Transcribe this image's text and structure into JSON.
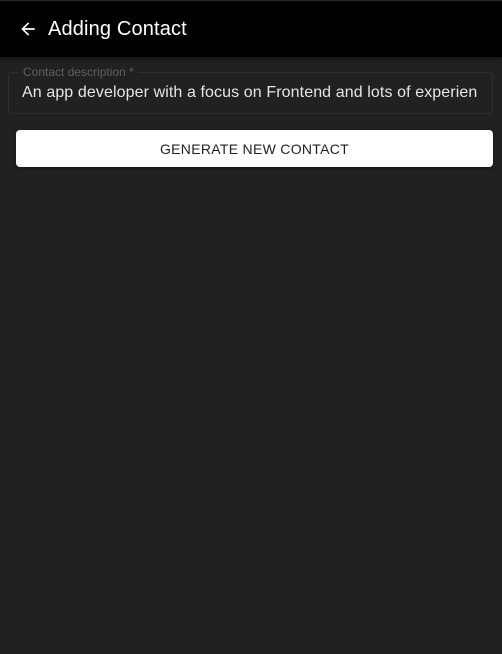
{
  "appbar": {
    "title": "Adding Contact",
    "back_icon": "arrow-left-icon"
  },
  "form": {
    "description_label": "Contact description *",
    "description_value": "An app developer with a focus on Frontend and lots of experien"
  },
  "actions": {
    "generate_label": "GENERATE NEW CONTACT"
  },
  "colors": {
    "appbar_bg": "#000000",
    "page_bg": "#212121",
    "button_bg": "#ffffff"
  }
}
